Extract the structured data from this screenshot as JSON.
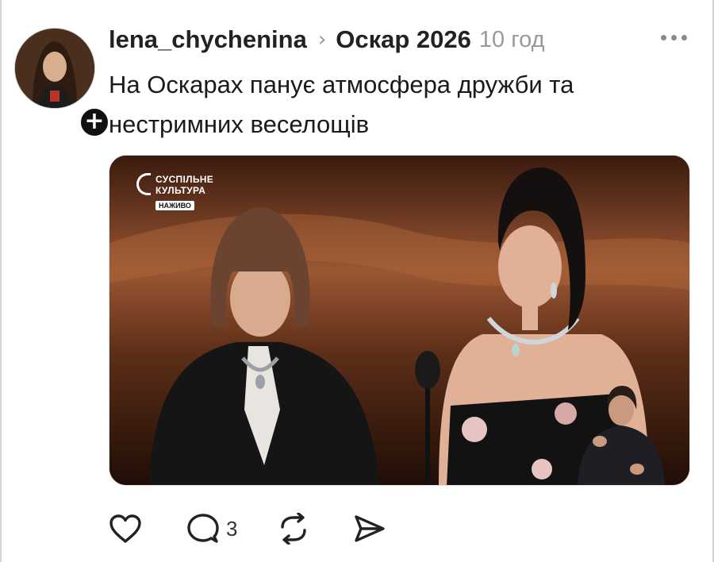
{
  "author": {
    "username": "lena_chychenina",
    "community": "Оскар 2026",
    "time_ago": "10 год",
    "follow_symbol": "+"
  },
  "post": {
    "text": "На Оскарах панує атмосфера дружби та нестримних веселощів"
  },
  "media": {
    "channel_line1": "СУСПІЛЬНЕ",
    "channel_line2": "КУЛЬТУРА",
    "live_label": "НАЖИВО"
  },
  "actions": {
    "like_icon": "heart-icon",
    "reply_icon": "comment-icon",
    "reply_count": "3",
    "repost_icon": "repost-icon",
    "share_icon": "send-icon"
  },
  "colors": {
    "text": "#1a1a1a",
    "muted": "#9a9a9a",
    "icon": "#222222"
  }
}
